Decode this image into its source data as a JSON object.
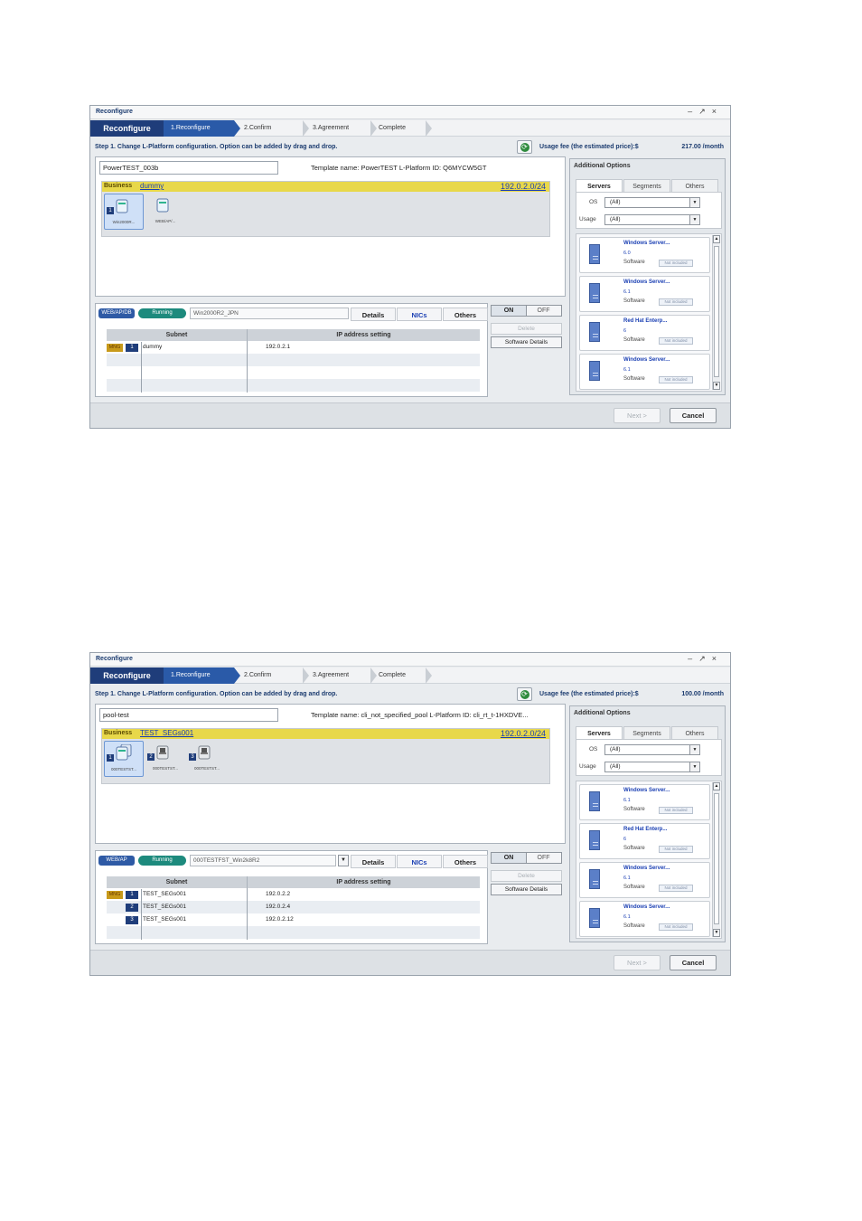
{
  "windows": [
    {
      "title": "Reconfigure",
      "wizard": {
        "brand": "Reconfigure",
        "steps": [
          "1.Reconfigure",
          "2.Confirm",
          "3.Agreement",
          "Complete"
        ]
      },
      "instruction": "Step 1. Change L-Platform configuration. Option can be added by drag and drop.",
      "usage_fee_label": "Usage fee (the estimated price):$",
      "usage_fee_value": "217.00 /month",
      "lplatform_name": "PowerTEST_003b",
      "template_info": "Template name: PowerTEST   L-Platform ID: Q6MYCW5GT",
      "segment": {
        "label": "Business",
        "name": "dummy",
        "network": "192.0.2.0/24",
        "servers": [
          {
            "num": "1",
            "caption": "Win2000R..."
          },
          {
            "num": "",
            "caption": "WEB/AP/..."
          }
        ]
      },
      "server": {
        "role": "WEB/AP/DB",
        "status": "Running",
        "name": "Win2000R2_JPN",
        "tabs": [
          "Details",
          "NICs",
          "Others"
        ],
        "table_headers": [
          "Subnet",
          "IP address setting"
        ],
        "nics": [
          {
            "mng": "MNG",
            "num": "1",
            "subnet": "dummy",
            "ip": "192.0.2.1"
          }
        ]
      },
      "side_buttons": {
        "on": "ON",
        "off": "OFF",
        "delete": "Delete",
        "software_details": "Software Details"
      },
      "additional": {
        "title": "Additional Options",
        "tabs": [
          "Servers",
          "Segments",
          "Others"
        ],
        "os_label": "OS",
        "os_value": "(All)",
        "usage_label": "Usage",
        "usage_value": "(All)",
        "cards": [
          {
            "name": "Windows Server...",
            "version": "6.0",
            "software": "Software",
            "status": "Not included"
          },
          {
            "name": "Windows Server...",
            "version": "6.1",
            "software": "Software",
            "status": "Not included"
          },
          {
            "name": "Red Hat Enterp...",
            "version": "6",
            "software": "Software",
            "status": "Not included"
          },
          {
            "name": "Windows Server...",
            "version": "6.1",
            "software": "Software",
            "status": "Not included"
          }
        ]
      },
      "footer": {
        "next": "Next >",
        "cancel": "Cancel"
      }
    },
    {
      "title": "Reconfigure",
      "wizard": {
        "brand": "Reconfigure",
        "steps": [
          "1.Reconfigure",
          "2.Confirm",
          "3.Agreement",
          "Complete"
        ]
      },
      "instruction": "Step 1. Change L-Platform configuration. Option can be added by drag and drop.",
      "usage_fee_label": "Usage fee (the estimated price):$",
      "usage_fee_value": "100.00 /month",
      "lplatform_name": "pool-test",
      "template_info": "Template name: cli_not_specified_pool  L-Platform ID: cli_rt_t-1HXDVE...",
      "segment": {
        "label": "Business",
        "name": "TEST_SEGs001",
        "network": "192.0.2.0/24",
        "servers": [
          {
            "num": "1",
            "caption": "000TESTST..."
          },
          {
            "num": "2",
            "caption": "000TESTST..."
          },
          {
            "num": "3",
            "caption": "000TESTST..."
          }
        ]
      },
      "server": {
        "role": "WEB/AP",
        "status": "Running",
        "name": "000TESTFST_Win2k8R2",
        "tabs": [
          "Details",
          "NICs",
          "Others"
        ],
        "table_headers": [
          "Subnet",
          "IP address setting"
        ],
        "nics": [
          {
            "mng": "MNG",
            "num": "1",
            "subnet": "TEST_SEGs001",
            "ip": "192.0.2.2"
          },
          {
            "mng": "",
            "num": "2",
            "subnet": "TEST_SEGs001",
            "ip": "192.0.2.4"
          },
          {
            "mng": "",
            "num": "3",
            "subnet": "TEST_SEGs001",
            "ip": "192.0.2.12"
          }
        ]
      },
      "side_buttons": {
        "on": "ON",
        "off": "OFF",
        "delete": "Delete",
        "software_details": "Software Details"
      },
      "additional": {
        "title": "Additional Options",
        "tabs": [
          "Servers",
          "Segments",
          "Others"
        ],
        "os_label": "OS",
        "os_value": "(All)",
        "usage_label": "Usage",
        "usage_value": "(All)",
        "cards": [
          {
            "name": "Windows Server...",
            "version": "6.1",
            "software": "Software",
            "status": "Not included"
          },
          {
            "name": "Red Hat Enterp...",
            "version": "6",
            "software": "Software",
            "status": "Not included"
          },
          {
            "name": "Windows Server...",
            "version": "6.1",
            "software": "Software",
            "status": "Not included"
          },
          {
            "name": "Windows Server...",
            "version": "6.1",
            "software": "Software",
            "status": "Not included"
          }
        ]
      },
      "footer": {
        "next": "Next >",
        "cancel": "Cancel"
      }
    }
  ],
  "icons": [
    "minimize-icon",
    "restore-icon",
    "close-icon",
    "refresh-icon",
    "server-icon",
    "chevron-down-icon",
    "scroll-up-icon",
    "scroll-down-icon"
  ],
  "colors": {
    "brand": "#1f3d7a",
    "active_step": "#2a5aa8",
    "segment_header": "#e8d84a",
    "running": "#1d8a7d",
    "link": "#1a3fb3"
  }
}
